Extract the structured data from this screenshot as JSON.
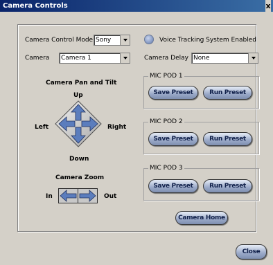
{
  "window": {
    "title": "Camera Controls",
    "close_glyph": "x"
  },
  "controls": {
    "mode_label": "Camera Control Mode",
    "mode_value": "Sony",
    "camera_label": "Camera",
    "camera_value": "Camera 1",
    "voice_label": "Voice Tracking System Enabled",
    "delay_label": "Camera Delay",
    "delay_value": "None"
  },
  "pan_tilt": {
    "title": "Camera Pan and Tilt",
    "up": "Up",
    "down": "Down",
    "left": "Left",
    "right": "Right"
  },
  "zoom": {
    "title": "Camera Zoom",
    "in": "In",
    "out": "Out"
  },
  "mic_pods": [
    {
      "label": "MIC POD 1",
      "save": "Save Preset",
      "run": "Run Preset"
    },
    {
      "label": "MIC POD 2",
      "save": "Save Preset",
      "run": "Run Preset"
    },
    {
      "label": "MIC POD 3",
      "save": "Save Preset",
      "run": "Run Preset"
    }
  ],
  "home_button": "Camera Home",
  "close_button": "Close",
  "colors": {
    "accent": "#5b7dbd",
    "title_bar": "#0a246a",
    "background": "#d4d0c8"
  }
}
